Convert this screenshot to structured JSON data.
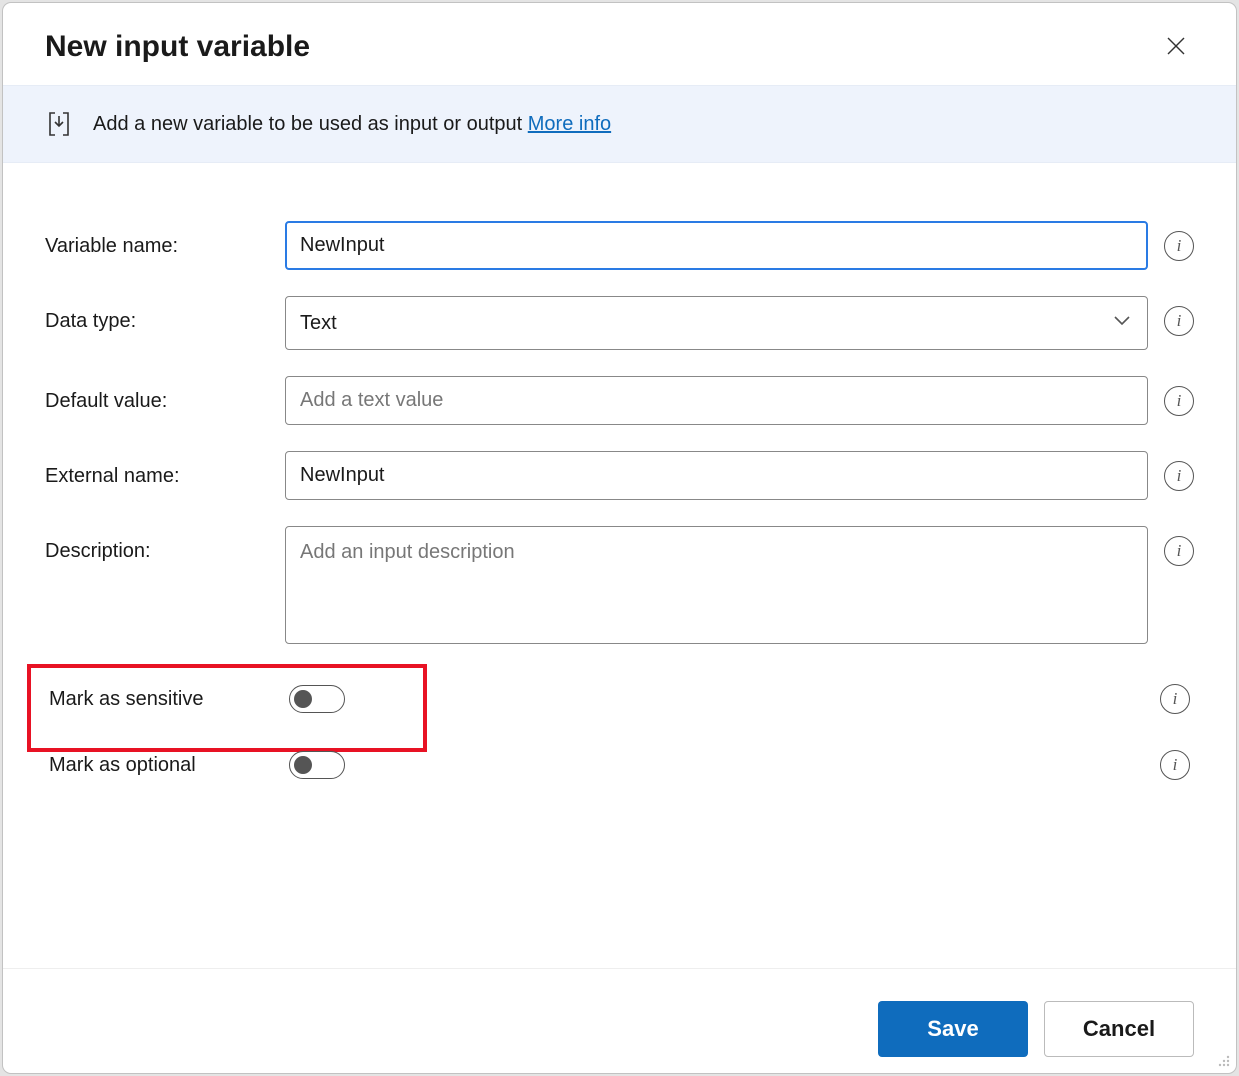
{
  "dialog": {
    "title": "New input variable",
    "close_label": "Close"
  },
  "banner": {
    "icon_name": "input-variable-icon",
    "text": "Add a new variable to be used as input or output ",
    "link_text": "More info"
  },
  "fields": {
    "variable_name": {
      "label": "Variable name:",
      "value": "NewInput",
      "placeholder": ""
    },
    "data_type": {
      "label": "Data type:",
      "value": "Text"
    },
    "default_value": {
      "label": "Default value:",
      "value": "",
      "placeholder": "Add a text value"
    },
    "external_name": {
      "label": "External name:",
      "value": "NewInput",
      "placeholder": ""
    },
    "description": {
      "label": "Description:",
      "value": "",
      "placeholder": "Add an input description"
    },
    "mark_sensitive": {
      "label": "Mark as sensitive",
      "value": false
    },
    "mark_optional": {
      "label": "Mark as optional",
      "value": false
    }
  },
  "footer": {
    "save_label": "Save",
    "cancel_label": "Cancel"
  }
}
